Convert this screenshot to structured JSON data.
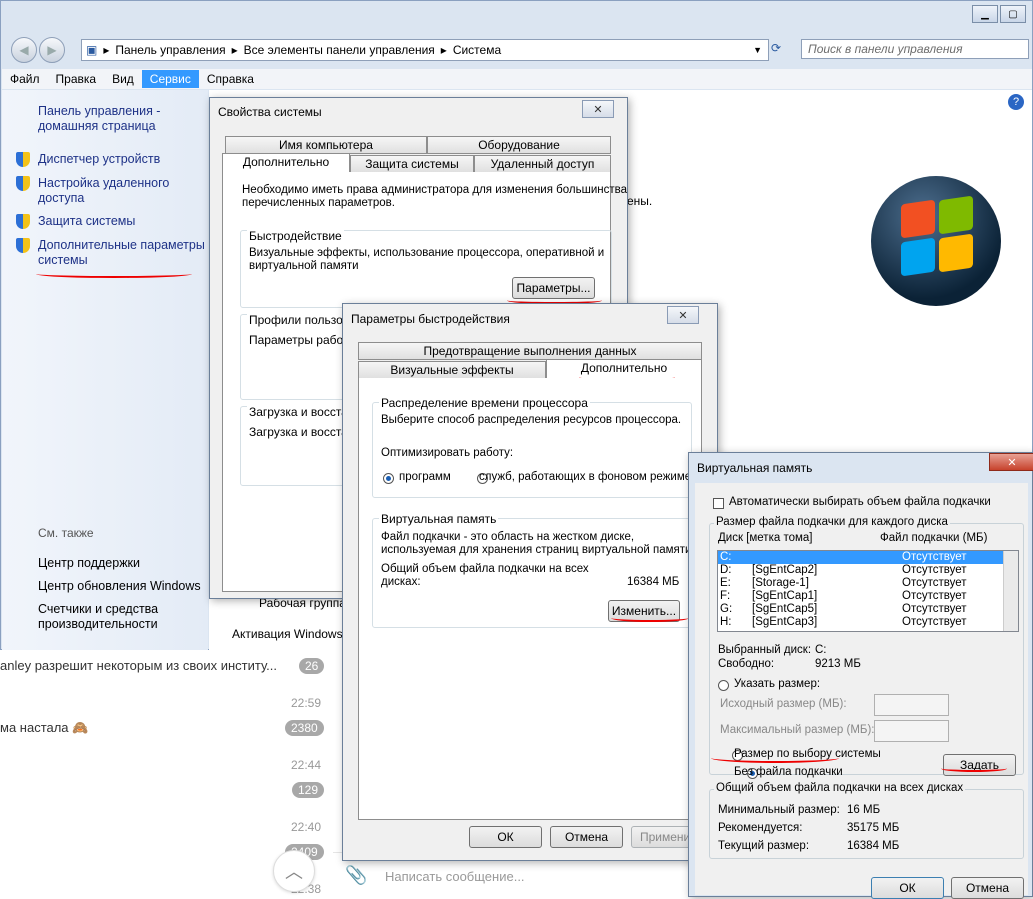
{
  "explorer": {
    "address": [
      "Панель управления",
      "Все элементы панели управления",
      "Система"
    ],
    "search_placeholder": "Поиск в панели управления",
    "menu": [
      "Файл",
      "Правка",
      "Вид",
      "Сервис",
      "Справка"
    ],
    "sidebar": {
      "home_link": "Панель управления -\nдомашняя страница",
      "items": [
        {
          "label": "Диспетчер устройств",
          "icon": "shield-icon"
        },
        {
          "label": "Настройка удаленного\nдоступа",
          "icon": "shield-icon"
        },
        {
          "label": "Защита системы",
          "icon": "shield-icon"
        },
        {
          "label": "Дополнительные параметры\nсистемы",
          "icon": "shield-icon"
        }
      ],
      "see_also": "См. также",
      "see_also_items": [
        "Центр поддержки",
        "Центр обновления Windows",
        "Счетчики и средства\nпроизводительности"
      ]
    },
    "content_fragment_1": "ены.",
    "content_fragment_2": "Рабочая группа:",
    "activation": "Активация Windows"
  },
  "chat": {
    "messages": [
      {
        "text": "anley разрешит некоторым из своих институ...",
        "badge": "26"
      },
      {
        "time": "22:59",
        "badge": "2380"
      },
      {
        "text": "ма настала 🙈"
      },
      {
        "time": "22:44",
        "badge": "129"
      },
      {
        "time": "22:40",
        "badge": "2409"
      },
      {
        "time": "22:38"
      }
    ],
    "composer_placeholder": "Написать сообщение..."
  },
  "sysprops": {
    "title": "Свойства системы",
    "tabs_top": [
      "Имя компьютера",
      "Оборудование"
    ],
    "tabs_bottom": [
      "Дополнительно",
      "Защита системы",
      "Удаленный доступ"
    ],
    "admin_note": "Необходимо иметь права администратора для изменения большинства\nперечисленных параметров.",
    "perf_group": "Быстродействие",
    "perf_text": "Визуальные эффекты, использование процессора, оперативной и\nвиртуальной памяти",
    "perf_button": "Параметры...",
    "profiles_group": "Профили пользова",
    "profiles_text": "Параметры рабоче",
    "startup_group": "Загрузка и восстан",
    "startup_text": "Загрузка и восстан",
    "ok": "ОК",
    "cancel": "Отмена",
    "apply": "Применить"
  },
  "perf": {
    "title": "Параметры быстродействия",
    "tab_top": "Предотвращение выполнения данных",
    "tabs": [
      "Визуальные эффекты",
      "Дополнительно"
    ],
    "cpu_group": "Распределение времени процессора",
    "cpu_text": "Выберите способ распределения ресурсов процессора.",
    "optimize_label": "Оптимизировать работу:",
    "radio_programs": "программ",
    "radio_services": "служб, работающих в фоновом режиме",
    "vm_group": "Виртуальная память",
    "vm_text": "Файл подкачки - это область на жестком диске,\nиспользуемая для хранения страниц виртуальной памяти.",
    "vm_total_label": "Общий объем файла подкачки на всех\nдисках:",
    "vm_total_value": "16384 МБ",
    "change_button": "Изменить..."
  },
  "vm": {
    "title": "Виртуальная память",
    "auto_check": "Автоматически выбирать объем файла подкачки",
    "per_drive_group": "Размер файла подкачки для каждого диска",
    "col_drive": "Диск [метка тома]",
    "col_size": "Файл подкачки (МБ)",
    "drives": [
      {
        "drive": "C:",
        "label": "",
        "size": "Отсутствует"
      },
      {
        "drive": "D:",
        "label": "[SgEntCap2]",
        "size": "Отсутствует"
      },
      {
        "drive": "E:",
        "label": "[Storage-1]",
        "size": "Отсутствует"
      },
      {
        "drive": "F:",
        "label": "[SgEntCap1]",
        "size": "Отсутствует"
      },
      {
        "drive": "G:",
        "label": "[SgEntCap5]",
        "size": "Отсутствует"
      },
      {
        "drive": "H:",
        "label": "[SgEntCap3]",
        "size": "Отсутствует"
      }
    ],
    "selected_label": "Выбранный диск:",
    "selected_value": "C:",
    "free_label": "Свободно:",
    "free_value": "9213 МБ",
    "radio_custom": "Указать размер:",
    "initial_label": "Исходный размер (МБ):",
    "max_label": "Максимальный размер (МБ):",
    "radio_system": "Размер по выбору системы",
    "radio_none": "Без файла подкачки",
    "set_button": "Задать",
    "total_group": "Общий объем файла подкачки на всех дисках",
    "min_label": "Минимальный размер:",
    "min_value": "16 МБ",
    "rec_label": "Рекомендуется:",
    "rec_value": "35175 МБ",
    "cur_label": "Текущий размер:",
    "cur_value": "16384 МБ",
    "ok": "ОК",
    "cancel": "Отмена"
  }
}
